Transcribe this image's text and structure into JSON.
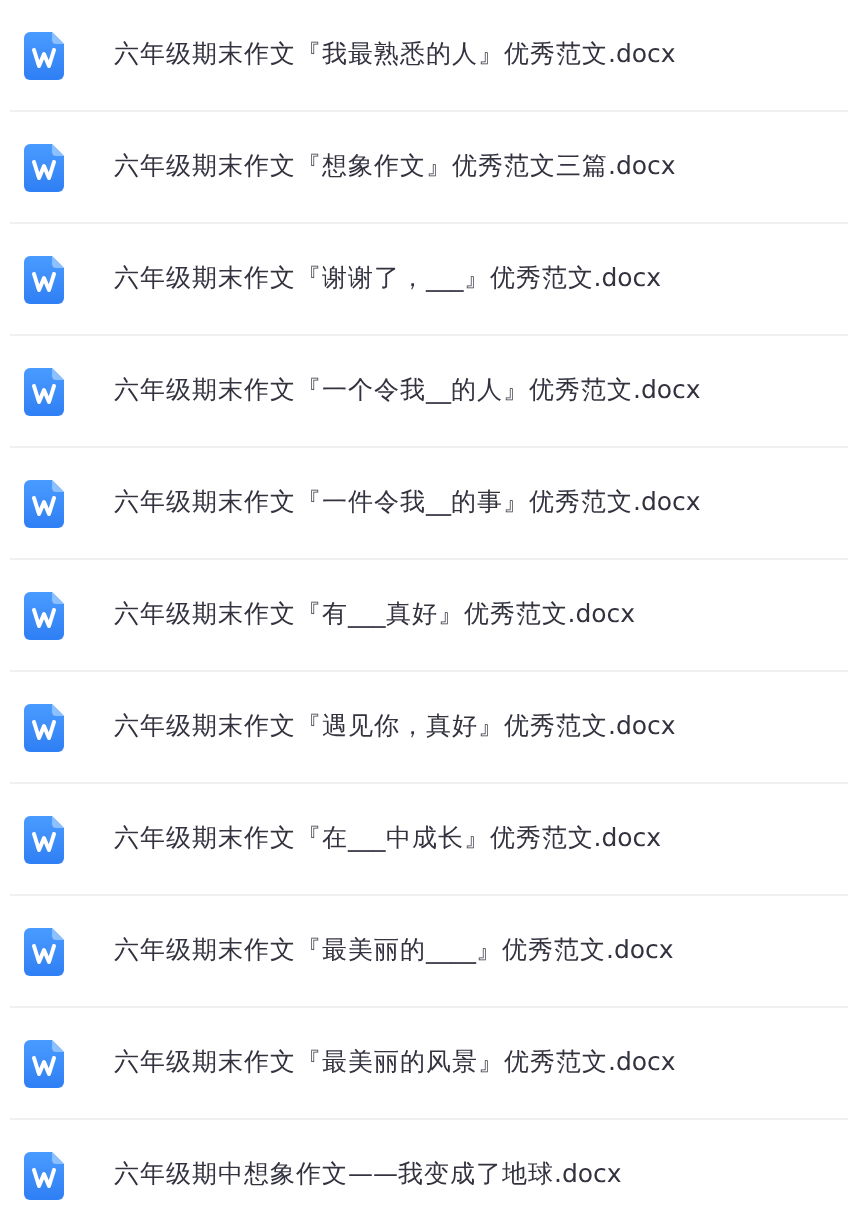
{
  "files": [
    {
      "name": "六年级期末作文『我最熟悉的人』优秀范文.docx"
    },
    {
      "name": "六年级期末作文『想象作文』优秀范文三篇.docx"
    },
    {
      "name": "六年级期末作文『谢谢了，___』优秀范文.docx"
    },
    {
      "name": "六年级期末作文『一个令我__的人』优秀范文.docx"
    },
    {
      "name": "六年级期末作文『一件令我__的事』优秀范文.docx"
    },
    {
      "name": "六年级期末作文『有___真好』优秀范文.docx"
    },
    {
      "name": "六年级期末作文『遇见你，真好』优秀范文.docx"
    },
    {
      "name": "六年级期末作文『在___中成长』优秀范文.docx"
    },
    {
      "name": "六年级期末作文『最美丽的____』优秀范文.docx"
    },
    {
      "name": "六年级期末作文『最美丽的风景』优秀范文.docx"
    },
    {
      "name": "六年级期中想象作文——我变成了地球.docx"
    }
  ]
}
